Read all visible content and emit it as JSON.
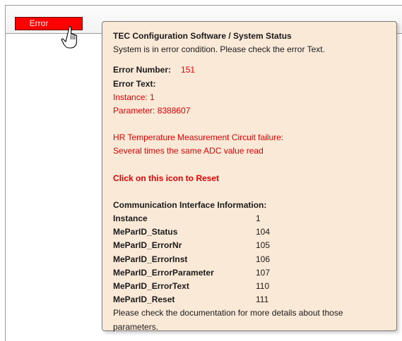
{
  "error_button": {
    "label": "Error"
  },
  "tooltip": {
    "title": "TEC Configuration Software / System Status",
    "subtitle": "System is in error condition. Please check the error Text.",
    "error_number_label": "Error Number:",
    "error_number_value": "151",
    "error_text_label": "Error Text:",
    "instance_line": "Instance: 1",
    "parameter_line": "Parameter: 8388607",
    "failure_line1": "HR Temperature Measurement Circuit failure:",
    "failure_line2": "Several times the same ADC value read",
    "reset_hint": "Click on this icon to Reset",
    "comm_header": "Communication Interface Information:",
    "comm_rows": [
      {
        "param": "Instance",
        "value": "1"
      },
      {
        "param": "MeParID_Status",
        "value": "104"
      },
      {
        "param": "MeParID_ErrorNr",
        "value": "105"
      },
      {
        "param": "MeParID_ErrorInst",
        "value": "106"
      },
      {
        "param": "MeParID_ErrorParameter",
        "value": "107"
      },
      {
        "param": "MeParID_ErrorText",
        "value": "110"
      },
      {
        "param": "MeParID_Reset",
        "value": "111"
      }
    ],
    "footer": "Please check the documentation for more details about those parameters."
  },
  "colors": {
    "error_red": "#ff0000",
    "text_red": "#e60000",
    "tooltip_bg": "#fbe9d8",
    "tooltip_border": "#7a7a7a"
  },
  "icons": {
    "cursor": "hand-pointer-cursor-icon"
  }
}
